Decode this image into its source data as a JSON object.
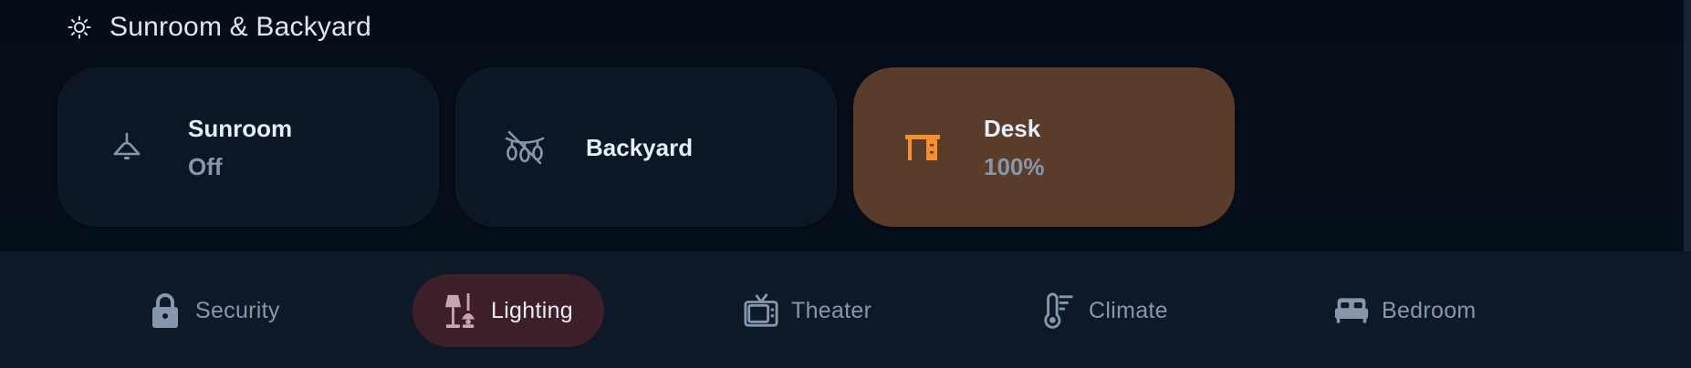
{
  "section": {
    "title": "Sunroom & Backyard",
    "icon": "sun-icon"
  },
  "cards": [
    {
      "name": "Sunroom",
      "state": "Off",
      "icon": "ceiling-lamp-icon",
      "active": false
    },
    {
      "name": "Backyard",
      "state": "",
      "icon": "string-lights-off-icon",
      "active": false
    },
    {
      "name": "Desk",
      "state": "100%",
      "icon": "desk-icon",
      "active": true,
      "accent": "#f7902c"
    }
  ],
  "nav": {
    "items": [
      {
        "label": "Security",
        "icon": "lock-icon",
        "active": false
      },
      {
        "label": "Lighting",
        "icon": "floor-lamp-icon",
        "active": true
      },
      {
        "label": "Theater",
        "icon": "tv-icon",
        "active": false
      },
      {
        "label": "Climate",
        "icon": "thermometer-icon",
        "active": false
      },
      {
        "label": "Bedroom",
        "icon": "bed-icon",
        "active": false
      }
    ]
  },
  "colors": {
    "background": "#07101c",
    "card": "#0b1724",
    "card_active": "#5a3c2a",
    "accent": "#f7902c",
    "nav_active": "#3d1f2a",
    "text_muted": "#8797ab"
  }
}
